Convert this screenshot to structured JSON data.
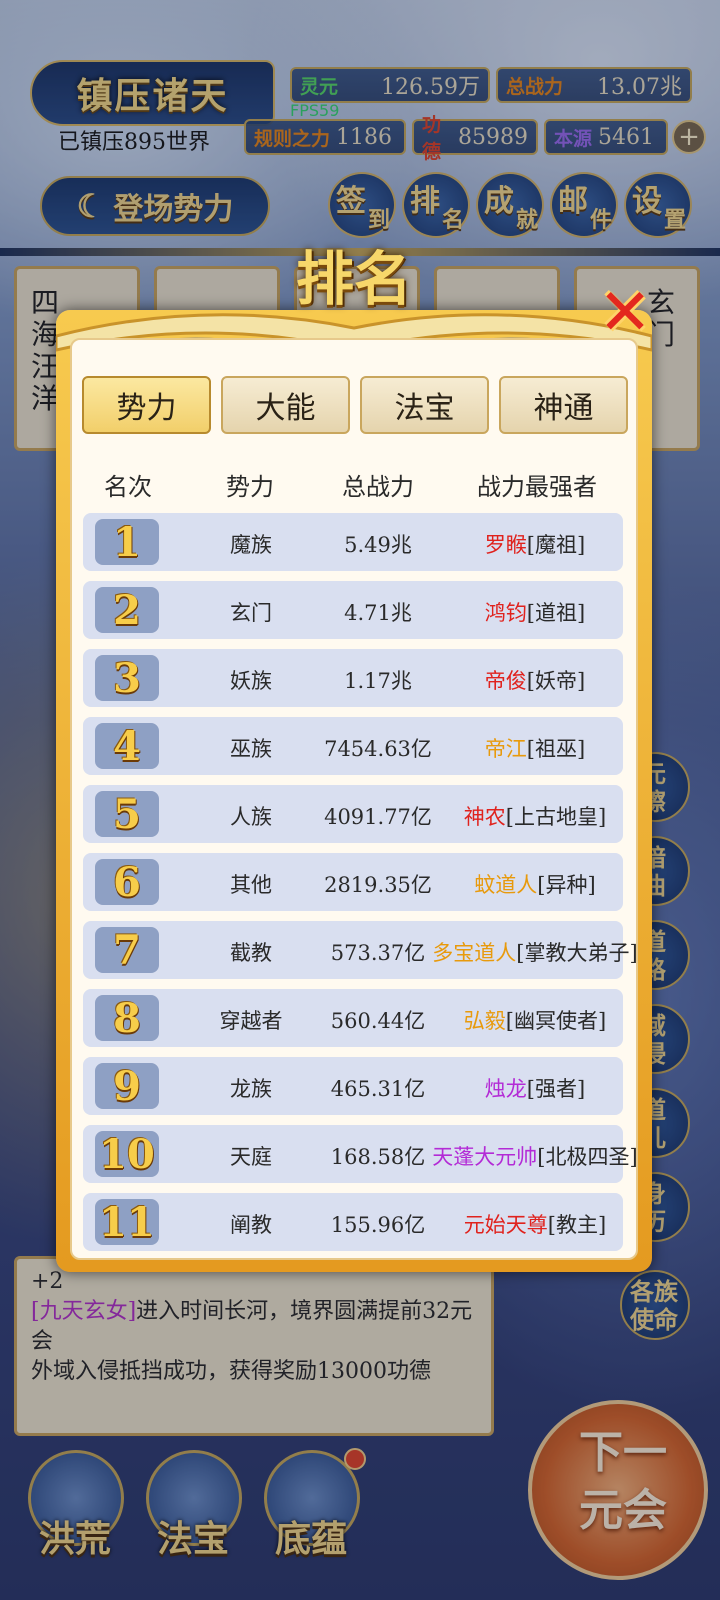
{
  "header": {
    "title": "镇压诸天",
    "subtitle": "已镇压895世界",
    "fps": "FPS59",
    "resources": [
      {
        "label": "灵元",
        "value": "126.59万",
        "color": "#57d867"
      },
      {
        "label": "总战力",
        "value": "13.07兆",
        "color": "#e8871a"
      },
      {
        "label": "规则之力",
        "value": "1186",
        "color": "#e8871a"
      },
      {
        "label": "功德",
        "value": "85989",
        "color": "#e0442a"
      },
      {
        "label": "本源",
        "value": "5461",
        "color": "#9b6df0"
      }
    ],
    "plus": "+",
    "enter_button": "登场势力",
    "menu": [
      {
        "c1": "签",
        "c2": "到"
      },
      {
        "c1": "排",
        "c2": "名"
      },
      {
        "c1": "成",
        "c2": "就"
      },
      {
        "c1": "邮",
        "c2": "件"
      },
      {
        "c1": "设",
        "c2": "置"
      }
    ]
  },
  "background_cards": {
    "left_text": "四海汪洋",
    "right_text": "玄门"
  },
  "side_buttons": [
    "元擦",
    "暗曲",
    "道路",
    "域侵",
    "道儿",
    "身历",
    "各族使命"
  ],
  "log": {
    "partial": "+2",
    "lines": [
      {
        "highlight": "[九天玄女]",
        "text": "进入时间长河，境界圆满提前32元会"
      },
      {
        "highlight": "",
        "text": "外域入侵抵挡成功，获得奖励13000功德"
      }
    ]
  },
  "bottom_nav": [
    "洪荒",
    "法宝",
    "底蕴"
  ],
  "next_button": "下一元会",
  "modal": {
    "title": "排名",
    "close": "✕",
    "tabs": [
      "势力",
      "大能",
      "法宝",
      "神通"
    ],
    "active_tab": 0,
    "columns": [
      "名次",
      "势力",
      "总战力",
      "战力最强者"
    ],
    "rows": [
      {
        "rank": "1",
        "faction": "魔族",
        "power": "5.49兆",
        "champion": "罗睺",
        "title": "[魔祖]",
        "color": "rd"
      },
      {
        "rank": "2",
        "faction": "玄门",
        "power": "4.71兆",
        "champion": "鸿钧",
        "title": "[道祖]",
        "color": "rd"
      },
      {
        "rank": "3",
        "faction": "妖族",
        "power": "1.17兆",
        "champion": "帝俊",
        "title": "[妖帝]",
        "color": "rd"
      },
      {
        "rank": "4",
        "faction": "巫族",
        "power": "7454.63亿",
        "champion": "帝江",
        "title": "[祖巫]",
        "color": "or"
      },
      {
        "rank": "5",
        "faction": "人族",
        "power": "4091.77亿",
        "champion": "神农",
        "title": "[上古地皇]",
        "color": "rd"
      },
      {
        "rank": "6",
        "faction": "其他",
        "power": "2819.35亿",
        "champion": "蚊道人",
        "title": "[异种]",
        "color": "or"
      },
      {
        "rank": "7",
        "faction": "截教",
        "power": "573.37亿",
        "champion": "多宝道人",
        "title": "[掌教大弟子]",
        "color": "or"
      },
      {
        "rank": "8",
        "faction": "穿越者",
        "power": "560.44亿",
        "champion": "弘毅",
        "title": "[幽冥使者]",
        "color": "or"
      },
      {
        "rank": "9",
        "faction": "龙族",
        "power": "465.31亿",
        "champion": "烛龙",
        "title": "[强者]",
        "color": "pu"
      },
      {
        "rank": "10",
        "faction": "天庭",
        "power": "168.58亿",
        "champion": "天蓬大元帅",
        "title": "[北极四圣]",
        "color": "pu"
      },
      {
        "rank": "11",
        "faction": "阐教",
        "power": "155.96亿",
        "champion": "元始天尊",
        "title": "[教主]",
        "color": "rd"
      }
    ]
  }
}
